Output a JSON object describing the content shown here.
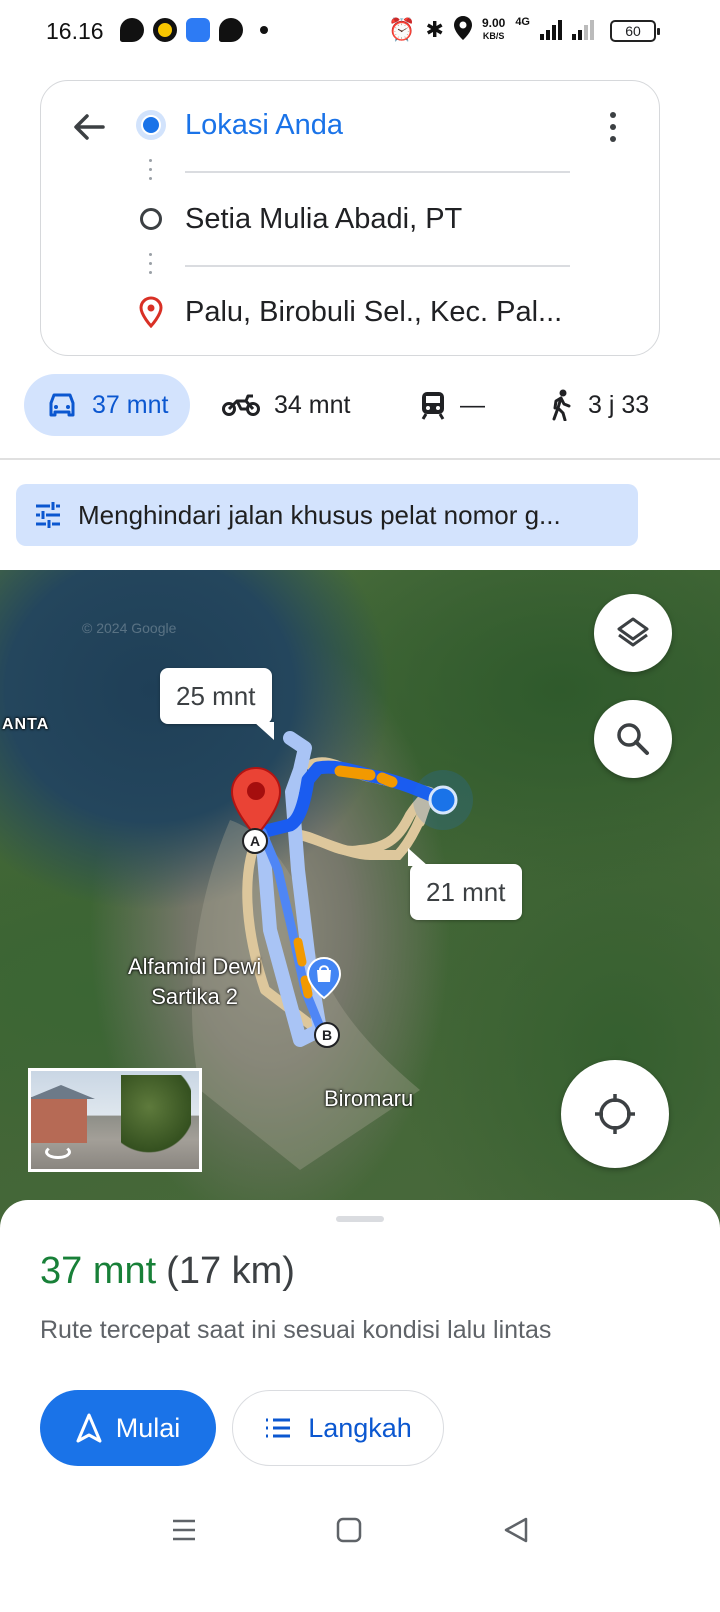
{
  "status_bar": {
    "time": "16.16",
    "net_speed_value": "9.00",
    "net_speed_unit": "KB/S",
    "network": "4G",
    "battery": "60"
  },
  "directions": {
    "origin": "Lokasi Anda",
    "stop": "Setia Mulia Abadi, PT",
    "destination": "Palu, Birobuli Sel., Kec. Pal...",
    "accent_color": "#1a73e8",
    "destination_color": "#d93025"
  },
  "modes": [
    {
      "icon": "car-icon",
      "label": "37 mnt"
    },
    {
      "icon": "motorcycle-icon",
      "label": "34 mnt"
    },
    {
      "icon": "train-icon",
      "label": "—"
    },
    {
      "icon": "walk-icon",
      "label": "3 j 33"
    }
  ],
  "avoid_chip": {
    "label": "Menghindari jalan khusus pelat nomor g..."
  },
  "map": {
    "copyright": "© 2024 Google",
    "route_labels": [
      "25 mnt",
      "21 mnt"
    ],
    "place_labels": {
      "poi": "Alfamidi Dewi\nSartika 2",
      "town": "Biromaru",
      "edge": "ANTA"
    },
    "markers": [
      "A",
      "B"
    ],
    "route_colors": {
      "primary": "#1a5cf0",
      "traffic": "#f29900",
      "alternate": "#d8c39a"
    }
  },
  "sheet": {
    "duration": "37 mnt",
    "distance": "(17 km)",
    "note": "Rute tercepat saat ini sesuai kondisi lalu lintas",
    "start_label": "Mulai",
    "steps_label": "Langkah"
  }
}
